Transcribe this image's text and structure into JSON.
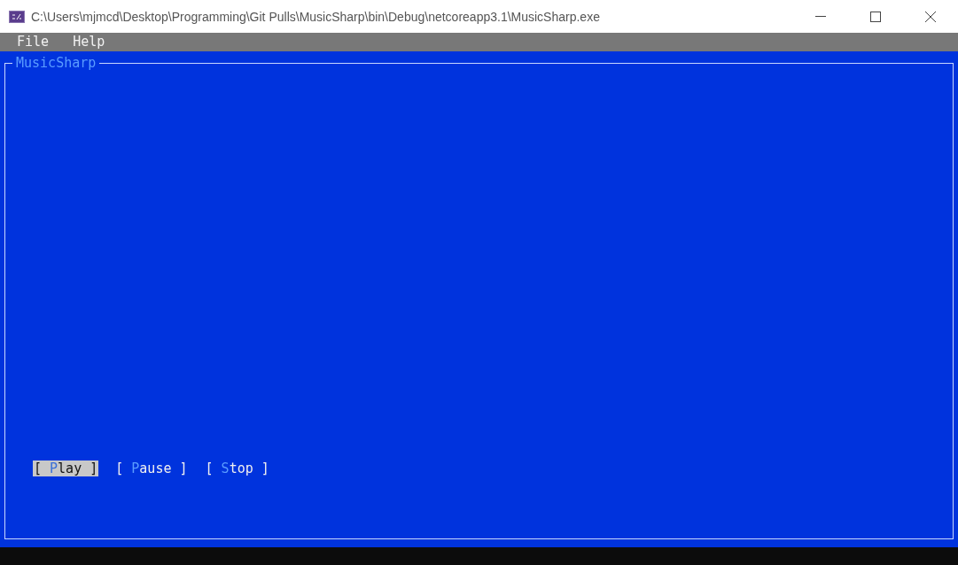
{
  "window": {
    "title": "C:\\Users\\mjmcd\\Desktop\\Programming\\Git Pulls\\MusicSharp\\bin\\Debug\\netcoreapp3.1\\MusicSharp.exe"
  },
  "menu": [
    {
      "label": "File"
    },
    {
      "label": "Help"
    }
  ],
  "frame": {
    "title": "MusicSharp"
  },
  "buttons": [
    {
      "before": "[ ",
      "hotkey": "P",
      "after": "lay ]",
      "selected": true
    },
    {
      "before": "[ ",
      "hotkey": "P",
      "after": "ause ]",
      "selected": false
    },
    {
      "before": "[ ",
      "hotkey": "S",
      "after": "top ]",
      "selected": false
    }
  ]
}
